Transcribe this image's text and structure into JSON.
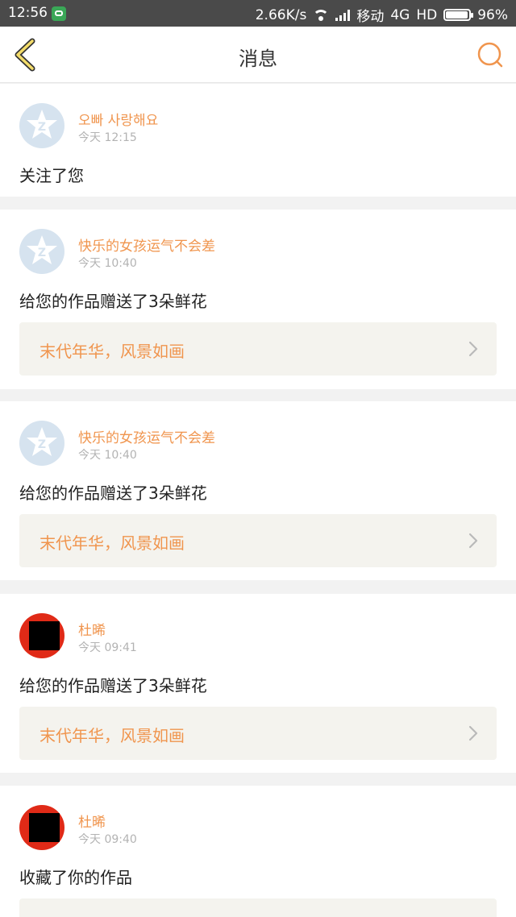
{
  "status_bar": {
    "time": "12:56",
    "speed": "2.66K/s",
    "carrier": "移动",
    "network": "4G",
    "hd": "HD",
    "battery": "96%"
  },
  "nav": {
    "title": "消息"
  },
  "colors": {
    "accent": "#f0954e",
    "card_bg": "#ffffff",
    "page_bg": "#f2f2f2",
    "work_bg": "#f4f3ee"
  },
  "notifications": [
    {
      "sender": "오빠 사랑해요",
      "time": "今天 12:15",
      "message": "关注了您",
      "avatar": "default-avatar-icon"
    },
    {
      "sender": "快乐的女孩运气不会差",
      "time": "今天 10:40",
      "message": "给您的作品赠送了3朵鲜花",
      "work_title": "末代年华，风景如画",
      "avatar": "default-avatar-icon"
    },
    {
      "sender": "快乐的女孩运气不会差",
      "time": "今天 10:40",
      "message": "给您的作品赠送了3朵鲜花",
      "work_title": "末代年华，风景如画",
      "avatar": "default-avatar-icon"
    },
    {
      "sender": "杜晞",
      "time": "今天 09:41",
      "message": "给您的作品赠送了3朵鲜花",
      "work_title": "末代年华，风景如画",
      "avatar": "user-avatar"
    },
    {
      "sender": "杜晞",
      "time": "今天 09:40",
      "message": "收藏了你的作品",
      "work_title": "",
      "avatar": "user-avatar"
    }
  ]
}
